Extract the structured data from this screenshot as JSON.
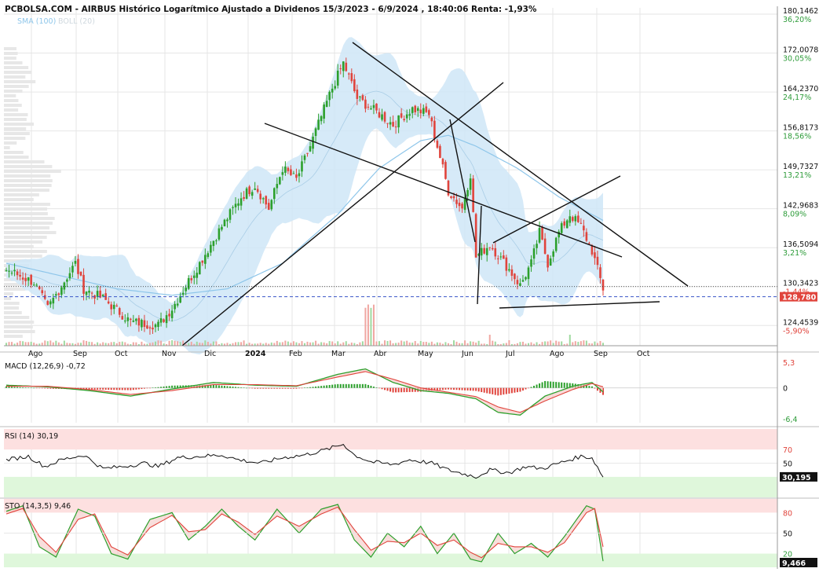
{
  "header": {
    "title": "PCBOLSA.COM - AIRBUS Histórico Logarítmico Ajustado a Dividenos 15/3/2023 - 6/9/2024 , 18:40:06 Renta: -1,93%",
    "sma_label": "SMA (100)",
    "boll_label": "BOLL (20)"
  },
  "colors": {
    "up": "#2ca02c",
    "down": "#e0443c",
    "sma": "#8ec6ea",
    "boll_fill": "#cfe6f7",
    "grid": "#e6e6e6",
    "pct_pos": "#2e9c3a",
    "pct_neg": "#e0443c",
    "price_tag": "#e0443c",
    "support": "#3a55c8"
  },
  "chart_data": [
    {
      "type": "candlestick",
      "name": "price",
      "scale": "log",
      "ylim": [
        121.5,
        181.5
      ],
      "x_labels": [
        "Ago",
        "Sep",
        "Oct",
        "Nov",
        "Dic",
        "2024",
        "Feb",
        "Mar",
        "Abr",
        "May",
        "Jun",
        "Jul",
        "Ago",
        "Sep",
        "Oct"
      ],
      "y_ticks": [
        {
          "price": "180,1462",
          "pct": "36,20%"
        },
        {
          "price": "172,0078",
          "pct": "30,05%"
        },
        {
          "price": "164,2370",
          "pct": "24,17%"
        },
        {
          "price": "156,8173",
          "pct": "18,56%"
        },
        {
          "price": "149,7327",
          "pct": "13,21%"
        },
        {
          "price": "142,9683",
          "pct": "8,09%"
        },
        {
          "price": "136,5094",
          "pct": "3,21%"
        },
        {
          "price": "130,3423",
          "pct": "-1,44%"
        },
        {
          "price": "124,4539",
          "pct": "-5,90%"
        }
      ],
      "last_price": "128,780",
      "reference_price": 130.34,
      "support_price": 128.78,
      "series_waypoints": [
        [
          0,
          133
        ],
        [
          10,
          131
        ],
        [
          15,
          127
        ],
        [
          25,
          134
        ],
        [
          28,
          130
        ],
        [
          35,
          128.5
        ],
        [
          45,
          125
        ],
        [
          55,
          124.5
        ],
        [
          60,
          127
        ],
        [
          70,
          134
        ],
        [
          78,
          140
        ],
        [
          85,
          145
        ],
        [
          90,
          147
        ],
        [
          95,
          143
        ],
        [
          100,
          150
        ],
        [
          105,
          148
        ],
        [
          110,
          154
        ],
        [
          118,
          165
        ],
        [
          122,
          170
        ],
        [
          127,
          163
        ],
        [
          135,
          160
        ],
        [
          140,
          158
        ],
        [
          147,
          161
        ],
        [
          153,
          160
        ],
        [
          160,
          146
        ],
        [
          165,
          143
        ],
        [
          168,
          149
        ],
        [
          170,
          135
        ],
        [
          175,
          137
        ],
        [
          182,
          133
        ],
        [
          186,
          130.5
        ],
        [
          190,
          134
        ],
        [
          193,
          139
        ],
        [
          196,
          134
        ],
        [
          200,
          139
        ],
        [
          204,
          142
        ],
        [
          208,
          140
        ],
        [
          212,
          136
        ],
        [
          216,
          130
        ]
      ],
      "sma_waypoints": [
        [
          0,
          134
        ],
        [
          20,
          132
        ],
        [
          40,
          130
        ],
        [
          60,
          129
        ],
        [
          80,
          130
        ],
        [
          100,
          134
        ],
        [
          120,
          142
        ],
        [
          135,
          150
        ],
        [
          150,
          155
        ],
        [
          160,
          156
        ],
        [
          170,
          154
        ],
        [
          185,
          150
        ],
        [
          200,
          145
        ],
        [
          216,
          141
        ]
      ],
      "annotations": "trendlines drawn on chart"
    },
    {
      "type": "line",
      "name": "MACD",
      "label": "MACD (12,26,9)",
      "value_label": "-0,72",
      "ylim": [
        -6.4,
        5.3
      ],
      "y_ticks": [
        "5,3",
        "0",
        "-6,4"
      ],
      "macd_waypoints": [
        [
          0,
          0.5
        ],
        [
          15,
          0.2
        ],
        [
          30,
          -0.5
        ],
        [
          45,
          -1.5
        ],
        [
          60,
          -0.2
        ],
        [
          75,
          1.0
        ],
        [
          90,
          0.5
        ],
        [
          105,
          0.3
        ],
        [
          120,
          2.5
        ],
        [
          130,
          3.5
        ],
        [
          140,
          1.0
        ],
        [
          150,
          -0.5
        ],
        [
          160,
          -1.0
        ],
        [
          170,
          -2.0
        ],
        [
          178,
          -4.5
        ],
        [
          186,
          -5.0
        ],
        [
          195,
          -1.5
        ],
        [
          205,
          0.3
        ],
        [
          212,
          1.0
        ],
        [
          216,
          -0.72
        ]
      ],
      "signal_waypoints": [
        [
          0,
          0.3
        ],
        [
          15,
          0.3
        ],
        [
          30,
          -0.3
        ],
        [
          45,
          -1.2
        ],
        [
          60,
          -0.5
        ],
        [
          75,
          0.6
        ],
        [
          90,
          0.6
        ],
        [
          105,
          0.4
        ],
        [
          120,
          2.0
        ],
        [
          130,
          3.0
        ],
        [
          140,
          1.6
        ],
        [
          150,
          0.0
        ],
        [
          160,
          -0.8
        ],
        [
          170,
          -1.6
        ],
        [
          178,
          -3.5
        ],
        [
          186,
          -4.5
        ],
        [
          195,
          -2.4
        ],
        [
          205,
          -0.3
        ],
        [
          212,
          0.8
        ],
        [
          216,
          0.2
        ]
      ]
    },
    {
      "type": "line",
      "name": "RSI",
      "label": "RSI (14)",
      "value_label": "30,19",
      "ylim": [
        0,
        100
      ],
      "y_ticks": [
        "70",
        "50"
      ],
      "last_value": "30,195",
      "waypoints": [
        [
          0,
          55
        ],
        [
          8,
          60
        ],
        [
          14,
          45
        ],
        [
          20,
          55
        ],
        [
          28,
          62
        ],
        [
          35,
          42
        ],
        [
          42,
          45
        ],
        [
          50,
          50
        ],
        [
          55,
          45
        ],
        [
          62,
          58
        ],
        [
          70,
          60
        ],
        [
          78,
          62
        ],
        [
          84,
          55
        ],
        [
          92,
          50
        ],
        [
          100,
          58
        ],
        [
          108,
          62
        ],
        [
          116,
          70
        ],
        [
          122,
          78
        ],
        [
          126,
          62
        ],
        [
          132,
          52
        ],
        [
          140,
          48
        ],
        [
          146,
          55
        ],
        [
          154,
          50
        ],
        [
          160,
          40
        ],
        [
          165,
          35
        ],
        [
          170,
          30
        ],
        [
          175,
          40
        ],
        [
          182,
          36
        ],
        [
          188,
          45
        ],
        [
          194,
          42
        ],
        [
          200,
          50
        ],
        [
          208,
          60
        ],
        [
          212,
          58
        ],
        [
          216,
          30
        ]
      ]
    },
    {
      "type": "line",
      "name": "STO",
      "label": "STO (14,3,5)",
      "value_label": "9,46",
      "ylim": [
        0,
        100
      ],
      "y_ticks": [
        "80",
        "50",
        "20"
      ],
      "last_value": "9,466",
      "k_waypoints": [
        [
          0,
          82
        ],
        [
          6,
          90
        ],
        [
          12,
          30
        ],
        [
          18,
          15
        ],
        [
          26,
          85
        ],
        [
          32,
          75
        ],
        [
          38,
          20
        ],
        [
          44,
          12
        ],
        [
          52,
          70
        ],
        [
          60,
          80
        ],
        [
          66,
          40
        ],
        [
          72,
          60
        ],
        [
          78,
          85
        ],
        [
          84,
          60
        ],
        [
          90,
          40
        ],
        [
          98,
          85
        ],
        [
          106,
          50
        ],
        [
          114,
          85
        ],
        [
          120,
          92
        ],
        [
          126,
          40
        ],
        [
          132,
          15
        ],
        [
          138,
          50
        ],
        [
          144,
          30
        ],
        [
          150,
          60
        ],
        [
          156,
          20
        ],
        [
          162,
          50
        ],
        [
          168,
          12
        ],
        [
          172,
          8
        ],
        [
          178,
          50
        ],
        [
          184,
          20
        ],
        [
          190,
          35
        ],
        [
          196,
          15
        ],
        [
          202,
          45
        ],
        [
          210,
          90
        ],
        [
          213,
          85
        ],
        [
          216,
          9
        ]
      ],
      "d_waypoints": [
        [
          0,
          78
        ],
        [
          6,
          86
        ],
        [
          12,
          45
        ],
        [
          18,
          22
        ],
        [
          26,
          70
        ],
        [
          32,
          78
        ],
        [
          38,
          30
        ],
        [
          44,
          18
        ],
        [
          52,
          58
        ],
        [
          60,
          76
        ],
        [
          66,
          52
        ],
        [
          72,
          55
        ],
        [
          78,
          78
        ],
        [
          84,
          66
        ],
        [
          90,
          48
        ],
        [
          98,
          75
        ],
        [
          106,
          60
        ],
        [
          114,
          78
        ],
        [
          120,
          88
        ],
        [
          126,
          55
        ],
        [
          132,
          25
        ],
        [
          138,
          38
        ],
        [
          144,
          36
        ],
        [
          150,
          50
        ],
        [
          156,
          32
        ],
        [
          162,
          40
        ],
        [
          168,
          22
        ],
        [
          172,
          14
        ],
        [
          178,
          35
        ],
        [
          184,
          30
        ],
        [
          190,
          30
        ],
        [
          196,
          22
        ],
        [
          202,
          36
        ],
        [
          210,
          80
        ],
        [
          213,
          86
        ],
        [
          216,
          30
        ]
      ]
    }
  ]
}
